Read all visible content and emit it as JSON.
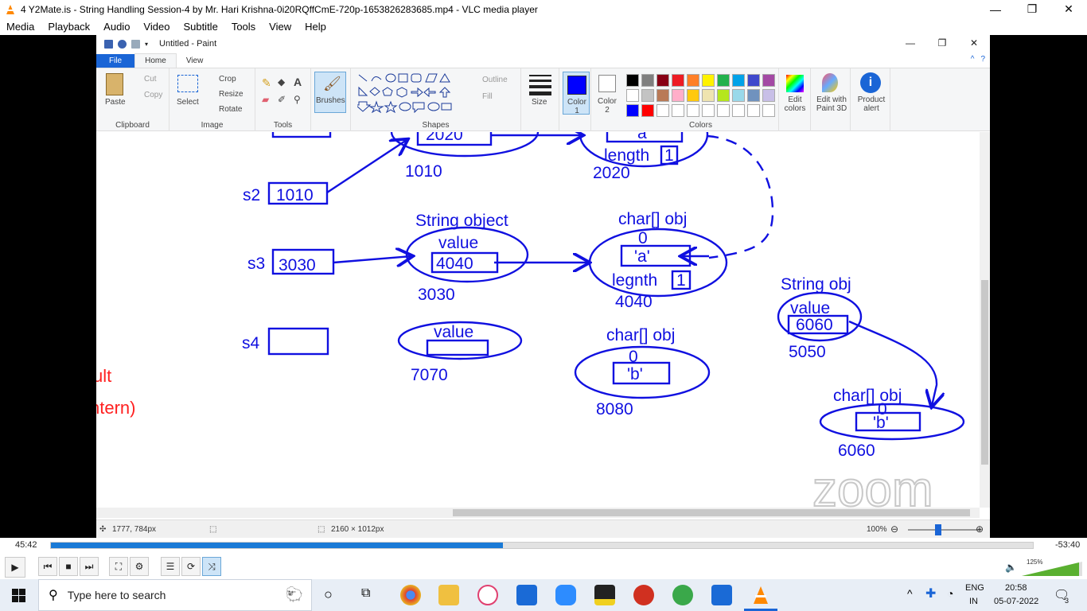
{
  "vlc": {
    "title": "4 Y2Mate.is - String Handling Session-4  by Mr. Hari Krishna-0i20RQffCmE-720p-1653826283685.mp4 - VLC media player",
    "menu": [
      "Media",
      "Playback",
      "Audio",
      "Video",
      "Subtitle",
      "Tools",
      "View",
      "Help"
    ],
    "time_elapsed": "45:42",
    "time_remaining": "-53:40",
    "progress": 0.46,
    "volume_label": "125%"
  },
  "paint": {
    "title": "Untitled - Paint",
    "tabs": [
      "File",
      "Home",
      "View"
    ],
    "clipboard": {
      "paste": "Paste",
      "cut": "Cut",
      "copy": "Copy",
      "label": "Clipboard"
    },
    "image": {
      "select": "Select",
      "crop": "Crop",
      "resize": "Resize",
      "rotate": "Rotate",
      "label": "Image"
    },
    "tools": {
      "label": "Tools",
      "brushes": "Brushes"
    },
    "shapes": {
      "label": "Shapes",
      "outline": "Outline",
      "fill": "Fill"
    },
    "size": "Size",
    "color1": "Color 1",
    "color2": "Color 2",
    "colors_label": "Colors",
    "edit_colors": "Edit colors",
    "edit_paint3d": "Edit with Paint 3D",
    "product_alert": "Product alert",
    "palette": [
      "#000000",
      "#7f7f7f",
      "#880015",
      "#ed1c24",
      "#ff7f27",
      "#fff200",
      "#22b14c",
      "#00a2e8",
      "#3f48cc",
      "#a349a4",
      "#ffffff",
      "#c3c3c3",
      "#b97a57",
      "#ffaec9",
      "#ffc90e",
      "#efe4b0",
      "#b5e61d",
      "#99d9ea",
      "#7092be",
      "#c8bfe7",
      "#0000ff",
      "#ff0000",
      "#ffffff",
      "#ffffff",
      "#ffffff",
      "#ffffff",
      "#ffffff",
      "#ffffff",
      "#ffffff",
      "#ffffff"
    ],
    "status": {
      "cursor": "1777, 784px",
      "size": "2160 × 1012px",
      "zoom": "100%"
    }
  },
  "drawing": {
    "labels": {
      "s2": "s2",
      "s2_val": "1010",
      "s3": "s3",
      "s3_val": "3030",
      "s4": "s4",
      "top_str_val": "2020",
      "top_str_addr": "1010",
      "top_char_a": "a",
      "top_length": "length",
      "top_length_val": "1",
      "top_char_addr": "2020",
      "mid_string_obj": "String object",
      "mid_value": "value",
      "mid_value_val": "4040",
      "mid_addr": "3030",
      "mid_char_obj": "char[] obj",
      "mid_index": "0",
      "mid_char": "'a'",
      "mid_legnth": "legnth",
      "mid_legnth_val": "1",
      "mid_char_addr": "4040",
      "bot_value": "value",
      "bot_addr": "7070",
      "bot_char_obj": "char[] obj",
      "bot_index": "0",
      "bot_char": "'b'",
      "bot_char_addr": "8080",
      "right_string_obj": "String obj",
      "right_value": "value",
      "right_value_val": "6060",
      "right_addr": "5050",
      "right_char_obj": "char[] obj",
      "right_index": "0",
      "right_char": "'b'",
      "right_char_addr": "6060",
      "left_frag1": "ult",
      "left_frag2": "ntern)",
      "zoom": "zoom"
    }
  },
  "taskbar": {
    "search_placeholder": "Type here to search",
    "lang_line1": "ENG",
    "lang_line2": "IN",
    "time": "20:58",
    "date": "05-07-2022",
    "notifications": "3"
  },
  "colors": {
    "ink": "#1010e0",
    "accent": "#1a65d6",
    "seek": "#1a7ad6"
  }
}
